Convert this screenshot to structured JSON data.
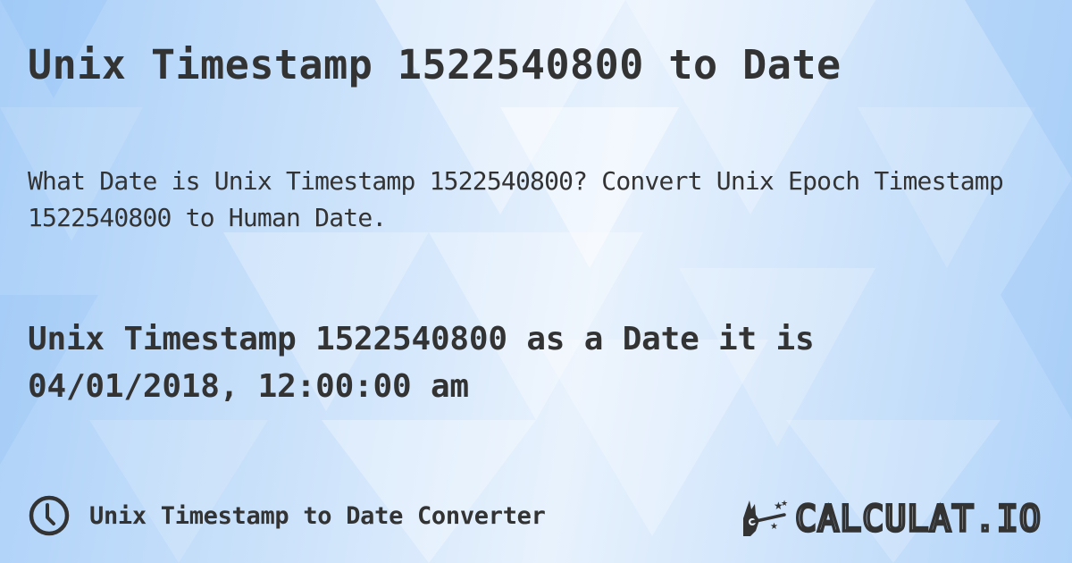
{
  "page": {
    "title": "Unix Timestamp 1522540800 to Date",
    "description": "What Date is Unix Timestamp 1522540800? Convert Unix Epoch Timestamp 1522540800 to Human Date.",
    "result_line1": "Unix Timestamp 1522540800 as a Date it is",
    "result_line2": "04/01/2018, 12:00:00 am"
  },
  "footer": {
    "icon": "clock-icon",
    "label": "Unix Timestamp to Date Converter",
    "brand": "CALCULAT.IO",
    "brand_icon": "magic-hand-icon"
  },
  "colors": {
    "text": "#333333",
    "background_light": "#e8f2fd",
    "background_blue": "#a9cff8"
  }
}
